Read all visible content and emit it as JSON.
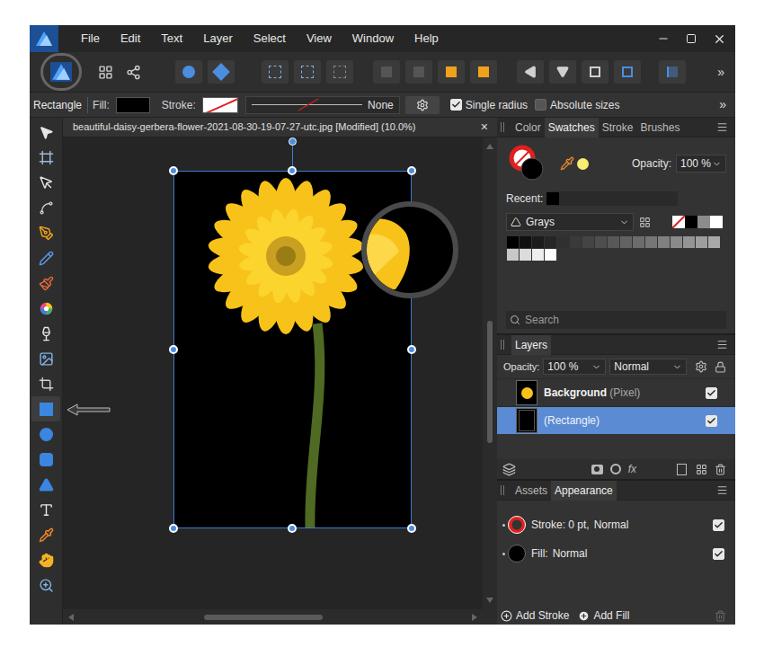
{
  "app": {
    "menu": [
      "File",
      "Edit",
      "Text",
      "Layer",
      "Select",
      "View",
      "Window",
      "Help"
    ]
  },
  "toolbar": {
    "overflow": "»"
  },
  "context_bar": {
    "tool": "Rectangle",
    "fill_label": "Fill:",
    "stroke_label": "Stroke:",
    "stroke_style": "None",
    "options": [
      {
        "label": "Single radius",
        "checked": true
      },
      {
        "label": "Absolute sizes",
        "checked": false
      }
    ],
    "overflow": "»"
  },
  "tools": [
    {
      "kind": "move",
      "selected": false
    },
    {
      "kind": "artboard",
      "selected": false
    },
    {
      "kind": "node",
      "selected": false
    },
    {
      "kind": "corner",
      "selected": false
    },
    {
      "kind": "pen",
      "selected": false
    },
    {
      "kind": "pencil",
      "selected": false
    },
    {
      "kind": "brush",
      "selected": false
    },
    {
      "kind": "fill",
      "selected": false
    },
    {
      "kind": "transparency",
      "selected": false
    },
    {
      "kind": "place",
      "selected": false
    },
    {
      "kind": "crop",
      "selected": false
    },
    {
      "kind": "rectangle",
      "selected": true
    },
    {
      "kind": "ellipse",
      "selected": false
    },
    {
      "kind": "rounded",
      "selected": false
    },
    {
      "kind": "triangle",
      "selected": false
    },
    {
      "kind": "text",
      "selected": false
    },
    {
      "kind": "picker",
      "selected": false
    },
    {
      "kind": "hand",
      "selected": false
    },
    {
      "kind": "zoom",
      "selected": false
    }
  ],
  "document": {
    "tab": "beautiful-daisy-gerbera-flower-2021-08-30-19-07-27-utc.jpg [Modified] (10.0%)",
    "close": "×",
    "h_scroll": {
      "position": 0.32,
      "level": 0.31
    },
    "v_scroll": {
      "position": 0.38,
      "level": 0.28
    }
  },
  "swatches_panel": {
    "tabs": [
      {
        "label": "Color",
        "selected": false
      },
      {
        "label": "Swatches",
        "selected": true
      },
      {
        "label": "Stroke",
        "selected": false
      },
      {
        "label": "Brushes",
        "selected": false
      }
    ],
    "opacity_label": "Opacity:",
    "opacity": "100 %",
    "recent_label": "Recent:",
    "recent": [
      {
        "color": "#000000"
      }
    ],
    "palette": "Grays",
    "quick": [
      {
        "kind": "none",
        "color": "#ffffff"
      },
      {
        "kind": "color",
        "color": "#000000"
      },
      {
        "kind": "color",
        "color": "#8c8c8c"
      },
      {
        "kind": "color",
        "color": "#ffffff"
      }
    ],
    "swatches": [
      {
        "color": "#000000"
      },
      {
        "color": "#101010"
      },
      {
        "color": "#1c1c1c"
      },
      {
        "color": "#262626"
      },
      {
        "color": "#303030"
      },
      {
        "color": "#3a3a3a"
      },
      {
        "color": "#444444"
      },
      {
        "color": "#4e4e4e"
      },
      {
        "color": "#585858"
      },
      {
        "color": "#626262"
      },
      {
        "color": "#6c6c6c"
      },
      {
        "color": "#767676"
      },
      {
        "color": "#808080"
      },
      {
        "color": "#8a8a8a"
      },
      {
        "color": "#949494"
      },
      {
        "color": "#9e9e9e"
      },
      {
        "color": "#a8a8a8"
      },
      {
        "color": "#c8c8c8"
      },
      {
        "color": "#dcdcdc"
      },
      {
        "color": "#eeeeee"
      },
      {
        "color": "#ffffff"
      }
    ],
    "search_placeholder": "Search"
  },
  "layers_panel": {
    "tabs": [
      {
        "label": "Layers",
        "selected": true
      }
    ],
    "opacity_label": "Opacity:",
    "opacity": "100 %",
    "blend": "Normal",
    "fx_label": "fx",
    "layers": [
      {
        "name": "Background",
        "type": "(Pixel)",
        "kind": "pixel",
        "selected": false,
        "visible": true
      },
      {
        "type": "(Rectangle)",
        "kind": "rectangle",
        "selected": true,
        "visible": true
      }
    ]
  },
  "appearance_panel": {
    "tabs": [
      {
        "label": "Assets",
        "selected": false
      },
      {
        "label": "Appearance",
        "selected": true
      }
    ],
    "items": [
      {
        "kind": "stroke",
        "label": "Stroke: 0 pt,",
        "blend": "Normal",
        "enabled": true
      },
      {
        "kind": "fill",
        "label": "Fill:",
        "blend": "Normal",
        "enabled": true
      }
    ],
    "buttons": [
      {
        "label": "Add Stroke",
        "kind": "outline"
      },
      {
        "label": "Add Fill",
        "kind": "filled"
      }
    ]
  }
}
